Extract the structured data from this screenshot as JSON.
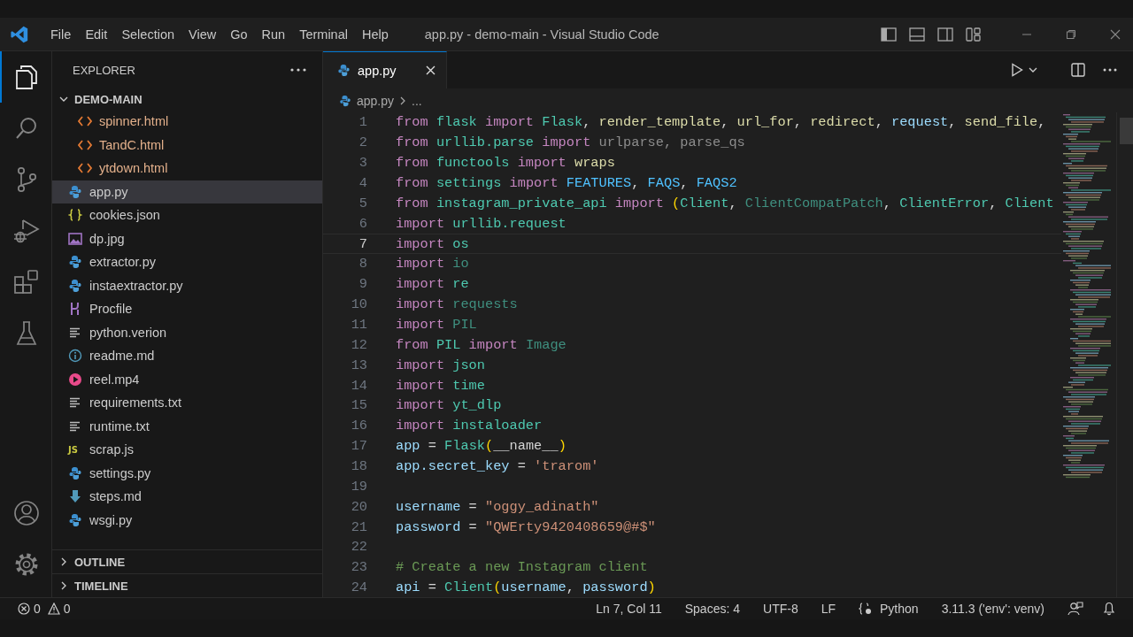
{
  "title_bar": {
    "menu": [
      "File",
      "Edit",
      "Selection",
      "View",
      "Go",
      "Run",
      "Terminal",
      "Help"
    ],
    "title": "app.py - demo-main - Visual Studio Code"
  },
  "activity_bar": {
    "top": [
      {
        "kind": "files",
        "selected": true
      },
      {
        "kind": "search",
        "selected": false
      },
      {
        "kind": "source-control",
        "selected": false
      },
      {
        "kind": "run-debug",
        "selected": false
      },
      {
        "kind": "extensions",
        "selected": false
      },
      {
        "kind": "testing",
        "selected": false
      }
    ],
    "bottom": [
      {
        "kind": "account",
        "selected": false
      },
      {
        "kind": "settings",
        "selected": false
      }
    ]
  },
  "sidebar": {
    "title": "EXPLORER",
    "folder": {
      "name": "DEMO-MAIN",
      "expanded": true,
      "items": [
        {
          "children": [
            {
              "name": "spinner.html",
              "kind": "html",
              "selected": false
            },
            {
              "name": "TandC.html",
              "kind": "html",
              "selected": false
            },
            {
              "name": "ytdown.html",
              "kind": "html",
              "selected": false
            }
          ]
        },
        {
          "name": "app.py",
          "kind": "python",
          "selected": true
        },
        {
          "name": "cookies.json",
          "kind": "json",
          "selected": false
        },
        {
          "name": "dp.jpg",
          "kind": "image",
          "selected": false
        },
        {
          "name": "extractor.py",
          "kind": "python",
          "selected": false
        },
        {
          "name": "instaextractor.py",
          "kind": "python",
          "selected": false
        },
        {
          "name": "Procfile",
          "kind": "procfile",
          "selected": false
        },
        {
          "name": "python.verion",
          "kind": "text",
          "selected": false
        },
        {
          "name": "readme.md",
          "kind": "info",
          "selected": false
        },
        {
          "name": "reel.mp4",
          "kind": "video",
          "selected": false
        },
        {
          "name": "requirements.txt",
          "kind": "text",
          "selected": false
        },
        {
          "name": "runtime.txt",
          "kind": "text",
          "selected": false
        },
        {
          "name": "scrap.js",
          "kind": "js",
          "badge": "JS",
          "selected": false
        },
        {
          "name": "settings.py",
          "kind": "python",
          "selected": false
        },
        {
          "name": "steps.md",
          "kind": "markdown",
          "selected": false
        },
        {
          "name": "wsgi.py",
          "kind": "python",
          "selected": false
        }
      ]
    },
    "sections": [
      {
        "name": "OUTLINE",
        "expanded": false
      },
      {
        "name": "TIMELINE",
        "expanded": false
      }
    ]
  },
  "tabs": [
    {
      "label": "app.py",
      "selected": true
    }
  ],
  "breadcrumb": {
    "file": "app.py",
    "rest": "..."
  },
  "editor": {
    "lines": [
      {
        "n": "1",
        "current": false,
        "tokens": [
          {
            "text": "from",
            "kind": "kw"
          },
          {
            "text": " flask",
            "kind": "mod"
          },
          {
            "text": " import",
            "kind": "kw"
          },
          {
            "text": " Flask",
            "kind": "cls"
          },
          {
            "text": ", ",
            "kind": "p"
          },
          {
            "text": "render_template",
            "kind": "func"
          },
          {
            "text": ", ",
            "kind": "p"
          },
          {
            "text": "url_for",
            "kind": "func"
          },
          {
            "text": ", ",
            "kind": "p"
          },
          {
            "text": "redirect",
            "kind": "func"
          },
          {
            "text": ", ",
            "kind": "p"
          },
          {
            "text": "request",
            "kind": "var"
          },
          {
            "text": ", ",
            "kind": "p"
          },
          {
            "text": "send_file",
            "kind": "func"
          },
          {
            "text": ",",
            "kind": "p"
          }
        ]
      },
      {
        "n": "2",
        "current": false,
        "tokens": [
          {
            "text": "from",
            "kind": "kw"
          },
          {
            "text": " urllib.parse",
            "kind": "mod"
          },
          {
            "text": " import",
            "kind": "kw"
          },
          {
            "text": " urlparse, parse_qs",
            "kind": "dim"
          }
        ]
      },
      {
        "n": "3",
        "current": false,
        "tokens": [
          {
            "text": "from",
            "kind": "kw"
          },
          {
            "text": " functools",
            "kind": "mod"
          },
          {
            "text": " import",
            "kind": "kw"
          },
          {
            "text": " wraps",
            "kind": "func"
          }
        ]
      },
      {
        "n": "4",
        "current": false,
        "tokens": [
          {
            "text": "from",
            "kind": "kw"
          },
          {
            "text": " settings",
            "kind": "mod"
          },
          {
            "text": " import",
            "kind": "kw"
          },
          {
            "text": " FEATURES",
            "kind": "const"
          },
          {
            "text": ", ",
            "kind": "p"
          },
          {
            "text": "FAQS",
            "kind": "const"
          },
          {
            "text": ", ",
            "kind": "p"
          },
          {
            "text": "FAQS2",
            "kind": "const"
          }
        ]
      },
      {
        "n": "5",
        "current": false,
        "tokens": [
          {
            "text": "from",
            "kind": "kw"
          },
          {
            "text": " instagram_private_api",
            "kind": "mod"
          },
          {
            "text": " import",
            "kind": "kw"
          },
          {
            "text": " (",
            "kind": "paren"
          },
          {
            "text": "Client",
            "kind": "cls"
          },
          {
            "text": ", ",
            "kind": "p"
          },
          {
            "text": "ClientCompatPatch",
            "kind": "dimcls"
          },
          {
            "text": ", ",
            "kind": "p"
          },
          {
            "text": "ClientError",
            "kind": "cls"
          },
          {
            "text": ", ",
            "kind": "p"
          },
          {
            "text": "Client",
            "kind": "cls"
          }
        ]
      },
      {
        "n": "6",
        "current": false,
        "tokens": [
          {
            "text": "import",
            "kind": "kw"
          },
          {
            "text": " urllib.request",
            "kind": "mod"
          }
        ]
      },
      {
        "n": "7",
        "current": true,
        "tokens": [
          {
            "text": "import",
            "kind": "kw"
          },
          {
            "text": " os",
            "kind": "mod"
          }
        ]
      },
      {
        "n": "8",
        "current": false,
        "tokens": [
          {
            "text": "import",
            "kind": "kw"
          },
          {
            "text": " io",
            "kind": "dimcls"
          }
        ]
      },
      {
        "n": "9",
        "current": false,
        "tokens": [
          {
            "text": "import",
            "kind": "kw"
          },
          {
            "text": " re",
            "kind": "mod"
          }
        ]
      },
      {
        "n": "10",
        "current": false,
        "tokens": [
          {
            "text": "import",
            "kind": "kw"
          },
          {
            "text": " requests",
            "kind": "dimcls"
          }
        ]
      },
      {
        "n": "11",
        "current": false,
        "tokens": [
          {
            "text": "import",
            "kind": "kw"
          },
          {
            "text": " PIL",
            "kind": "dimcls"
          }
        ]
      },
      {
        "n": "12",
        "current": false,
        "tokens": [
          {
            "text": "from",
            "kind": "kw"
          },
          {
            "text": " PIL",
            "kind": "mod"
          },
          {
            "text": " import",
            "kind": "kw"
          },
          {
            "text": " Image",
            "kind": "dimcls"
          }
        ]
      },
      {
        "n": "13",
        "current": false,
        "tokens": [
          {
            "text": "import",
            "kind": "kw"
          },
          {
            "text": " json",
            "kind": "mod"
          }
        ]
      },
      {
        "n": "14",
        "current": false,
        "tokens": [
          {
            "text": "import",
            "kind": "kw"
          },
          {
            "text": " time",
            "kind": "mod"
          }
        ]
      },
      {
        "n": "15",
        "current": false,
        "tokens": [
          {
            "text": "import",
            "kind": "kw"
          },
          {
            "text": " yt_dlp",
            "kind": "mod"
          }
        ]
      },
      {
        "n": "16",
        "current": false,
        "tokens": [
          {
            "text": "import",
            "kind": "kw"
          },
          {
            "text": " instaloader",
            "kind": "mod"
          }
        ]
      },
      {
        "n": "17",
        "current": false,
        "tokens": [
          {
            "text": "app",
            "kind": "var"
          },
          {
            "text": " = ",
            "kind": "p"
          },
          {
            "text": "Flask",
            "kind": "cls"
          },
          {
            "text": "(",
            "kind": "paren"
          },
          {
            "text": "__name__",
            "kind": "p"
          },
          {
            "text": ")",
            "kind": "paren"
          }
        ]
      },
      {
        "n": "18",
        "current": false,
        "tokens": [
          {
            "text": "app.secret_key",
            "kind": "var"
          },
          {
            "text": " = ",
            "kind": "p"
          },
          {
            "text": "'trarom'",
            "kind": "str"
          }
        ]
      },
      {
        "n": "19",
        "current": false
      },
      {
        "n": "20",
        "current": false,
        "tokens": [
          {
            "text": "username",
            "kind": "var"
          },
          {
            "text": " = ",
            "kind": "p"
          },
          {
            "text": "\"oggy_adinath\"",
            "kind": "str"
          }
        ]
      },
      {
        "n": "21",
        "current": false,
        "tokens": [
          {
            "text": "password",
            "kind": "var"
          },
          {
            "text": " = ",
            "kind": "p"
          },
          {
            "text": "\"QWErty9420408659@#$\"",
            "kind": "str"
          }
        ]
      },
      {
        "n": "22",
        "current": false
      },
      {
        "n": "23",
        "current": false,
        "tokens": [
          {
            "text": "# Create a new Instagram client",
            "kind": "comment"
          }
        ]
      },
      {
        "n": "24",
        "current": false,
        "tokens": [
          {
            "text": "api",
            "kind": "var"
          },
          {
            "text": " = ",
            "kind": "p"
          },
          {
            "text": "Client",
            "kind": "cls"
          },
          {
            "text": "(",
            "kind": "paren"
          },
          {
            "text": "username",
            "kind": "var"
          },
          {
            "text": ", ",
            "kind": "p"
          },
          {
            "text": "password",
            "kind": "var"
          },
          {
            "text": ")",
            "kind": "paren"
          }
        ]
      }
    ]
  },
  "status_bar": {
    "errors": "0",
    "warnings": "0",
    "items": [
      "Ln 7, Col 11",
      "Spaces: 4",
      "UTF-8",
      "LF"
    ],
    "language": "Python",
    "interpreter": "3.11.3 ('env': venv)"
  }
}
